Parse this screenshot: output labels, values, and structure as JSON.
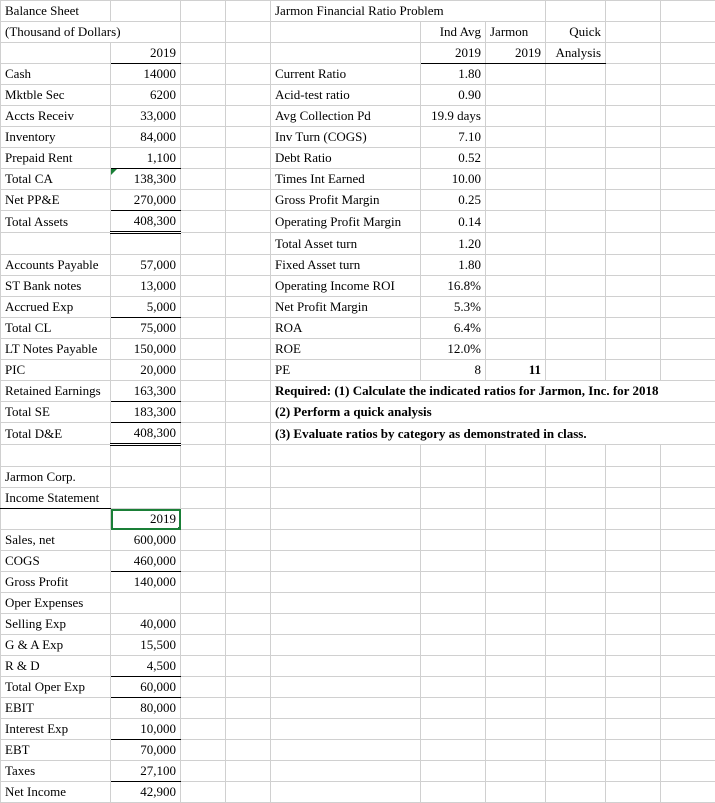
{
  "bs": {
    "title": "Balance Sheet",
    "subtitle": "(Thousand of Dollars)",
    "year": "2019",
    "rows": {
      "cash": {
        "label": "Cash",
        "val": "14000"
      },
      "mktble": {
        "label": "Mktble Sec",
        "val": "6200"
      },
      "ar": {
        "label": "Accts Receiv",
        "val": "33,000"
      },
      "inv": {
        "label": "Inventory",
        "val": "84,000"
      },
      "ppr": {
        "label": "Prepaid Rent",
        "val": "1,100"
      },
      "tca": {
        "label": "  Total CA",
        "val": "138,300"
      },
      "ppe": {
        "label": "Net PP&E",
        "val": "270,000"
      },
      "ta": {
        "label": "Total Assets",
        "val": "408,300"
      },
      "ap": {
        "label": "Accounts Payable",
        "val": "57,000"
      },
      "stbn": {
        "label": "ST Bank notes",
        "val": "13,000"
      },
      "ae": {
        "label": "Accrued Exp",
        "val": "5,000"
      },
      "tcl": {
        "label": "  Total CL",
        "val": "75,000"
      },
      "ltnp": {
        "label": "LT Notes Payable",
        "val": "150,000"
      },
      "pic": {
        "label": "PIC",
        "val": "20,000"
      },
      "re": {
        "label": "Retained Earnings",
        "val": "163,300"
      },
      "tse": {
        "label": "  Total SE",
        "val": "183,300"
      },
      "tde": {
        "label": "Total D&E",
        "val": "408,300"
      }
    }
  },
  "ratios": {
    "title": "Jarmon Financial Ratio Problem",
    "hdr_indavg": "Ind Avg",
    "hdr_jarmon": "Jarmon",
    "hdr_quick": "Quick",
    "hdr_2019a": "2019",
    "hdr_2019b": "2019",
    "hdr_analysis": "Analysis",
    "rows": {
      "cr": {
        "label": "Current Ratio",
        "val": "1.80"
      },
      "at": {
        "label": "Acid-test ratio",
        "val": "0.90"
      },
      "acp": {
        "label": "Avg Collection Pd",
        "val": "19.9 days"
      },
      "it": {
        "label": "Inv Turn (COGS)",
        "val": "7.10"
      },
      "dr": {
        "label": "Debt Ratio",
        "val": "0.52"
      },
      "tie": {
        "label": "Times Int Earned",
        "val": "10.00"
      },
      "gpm": {
        "label": "Gross Profit Margin",
        "val": "0.25"
      },
      "opm": {
        "label": "Operating Profit Margin",
        "val": "0.14"
      },
      "tat": {
        "label": "Total Asset turn",
        "val": "1.20"
      },
      "fat": {
        "label": "Fixed Asset turn",
        "val": "1.80"
      },
      "oir": {
        "label": "Operating Income ROI",
        "val": "16.8%"
      },
      "npm": {
        "label": "Net Profit Margin",
        "val": "5.3%"
      },
      "roa": {
        "label": "ROA",
        "val": "6.4%"
      },
      "roe": {
        "label": "ROE",
        "val": "12.0%"
      },
      "pe": {
        "label": "PE",
        "val": "8",
        "jarmon": "11"
      }
    },
    "req1": "Required: (1) Calculate the indicated ratios for Jarmon, Inc. for 2018",
    "req2": " (2) Perform a quick analysis",
    "req3": " (3) Evaluate ratios by category as demonstrated in class."
  },
  "is": {
    "corp": "Jarmon Corp.",
    "title": "Income Statement",
    "year": "2019",
    "rows": {
      "sales": {
        "label": "Sales, net",
        "val": "600,000"
      },
      "cogs": {
        "label": "COGS",
        "val": "460,000"
      },
      "gp": {
        "label": "  Gross Profit",
        "val": "140,000"
      },
      "oe": {
        "label": "Oper Expenses",
        "val": ""
      },
      "se": {
        "label": "  Selling Exp",
        "val": "40,000"
      },
      "ga": {
        "label": "  G & A Exp",
        "val": "15,500"
      },
      "rd": {
        "label": "R & D",
        "val": "4,500"
      },
      "toe": {
        "label": "Total Oper Exp",
        "val": "60,000"
      },
      "ebit": {
        "label": "EBIT",
        "val": "80,000"
      },
      "ie": {
        "label": "Interest Exp",
        "val": "10,000"
      },
      "ebt": {
        "label": "EBT",
        "val": "70,000"
      },
      "tax": {
        "label": "Taxes",
        "val": "27,100"
      },
      "ni": {
        "label": "Net Income",
        "val": "42,900"
      }
    }
  },
  "chart_data": {
    "type": "table",
    "title": "Jarmon Financial Ratio Problem",
    "balance_sheet_2019_thousands": {
      "Cash": 14000,
      "Mktble Sec": 6200,
      "Accts Receiv": 33000,
      "Inventory": 84000,
      "Prepaid Rent": 1100,
      "Total CA": 138300,
      "Net PP&E": 270000,
      "Total Assets": 408300,
      "Accounts Payable": 57000,
      "ST Bank notes": 13000,
      "Accrued Exp": 5000,
      "Total CL": 75000,
      "LT Notes Payable": 150000,
      "PIC": 20000,
      "Retained Earnings": 163300,
      "Total SE": 183300,
      "Total D&E": 408300
    },
    "income_statement_2019": {
      "Sales net": 600000,
      "COGS": 460000,
      "Gross Profit": 140000,
      "Selling Exp": 40000,
      "G&A Exp": 15500,
      "R&D": 4500,
      "Total Oper Exp": 60000,
      "EBIT": 80000,
      "Interest Exp": 10000,
      "EBT": 70000,
      "Taxes": 27100,
      "Net Income": 42900
    },
    "industry_avg_ratios_2019": {
      "Current Ratio": 1.8,
      "Acid-test ratio": 0.9,
      "Avg Collection Pd days": 19.9,
      "Inv Turn (COGS)": 7.1,
      "Debt Ratio": 0.52,
      "Times Int Earned": 10.0,
      "Gross Profit Margin": 0.25,
      "Operating Profit Margin": 0.14,
      "Total Asset turn": 1.2,
      "Fixed Asset turn": 1.8,
      "Operating Income ROI pct": 16.8,
      "Net Profit Margin pct": 5.3,
      "ROA pct": 6.4,
      "ROE pct": 12.0,
      "PE": 8
    },
    "jarmon_2019": {
      "PE": 11
    }
  }
}
